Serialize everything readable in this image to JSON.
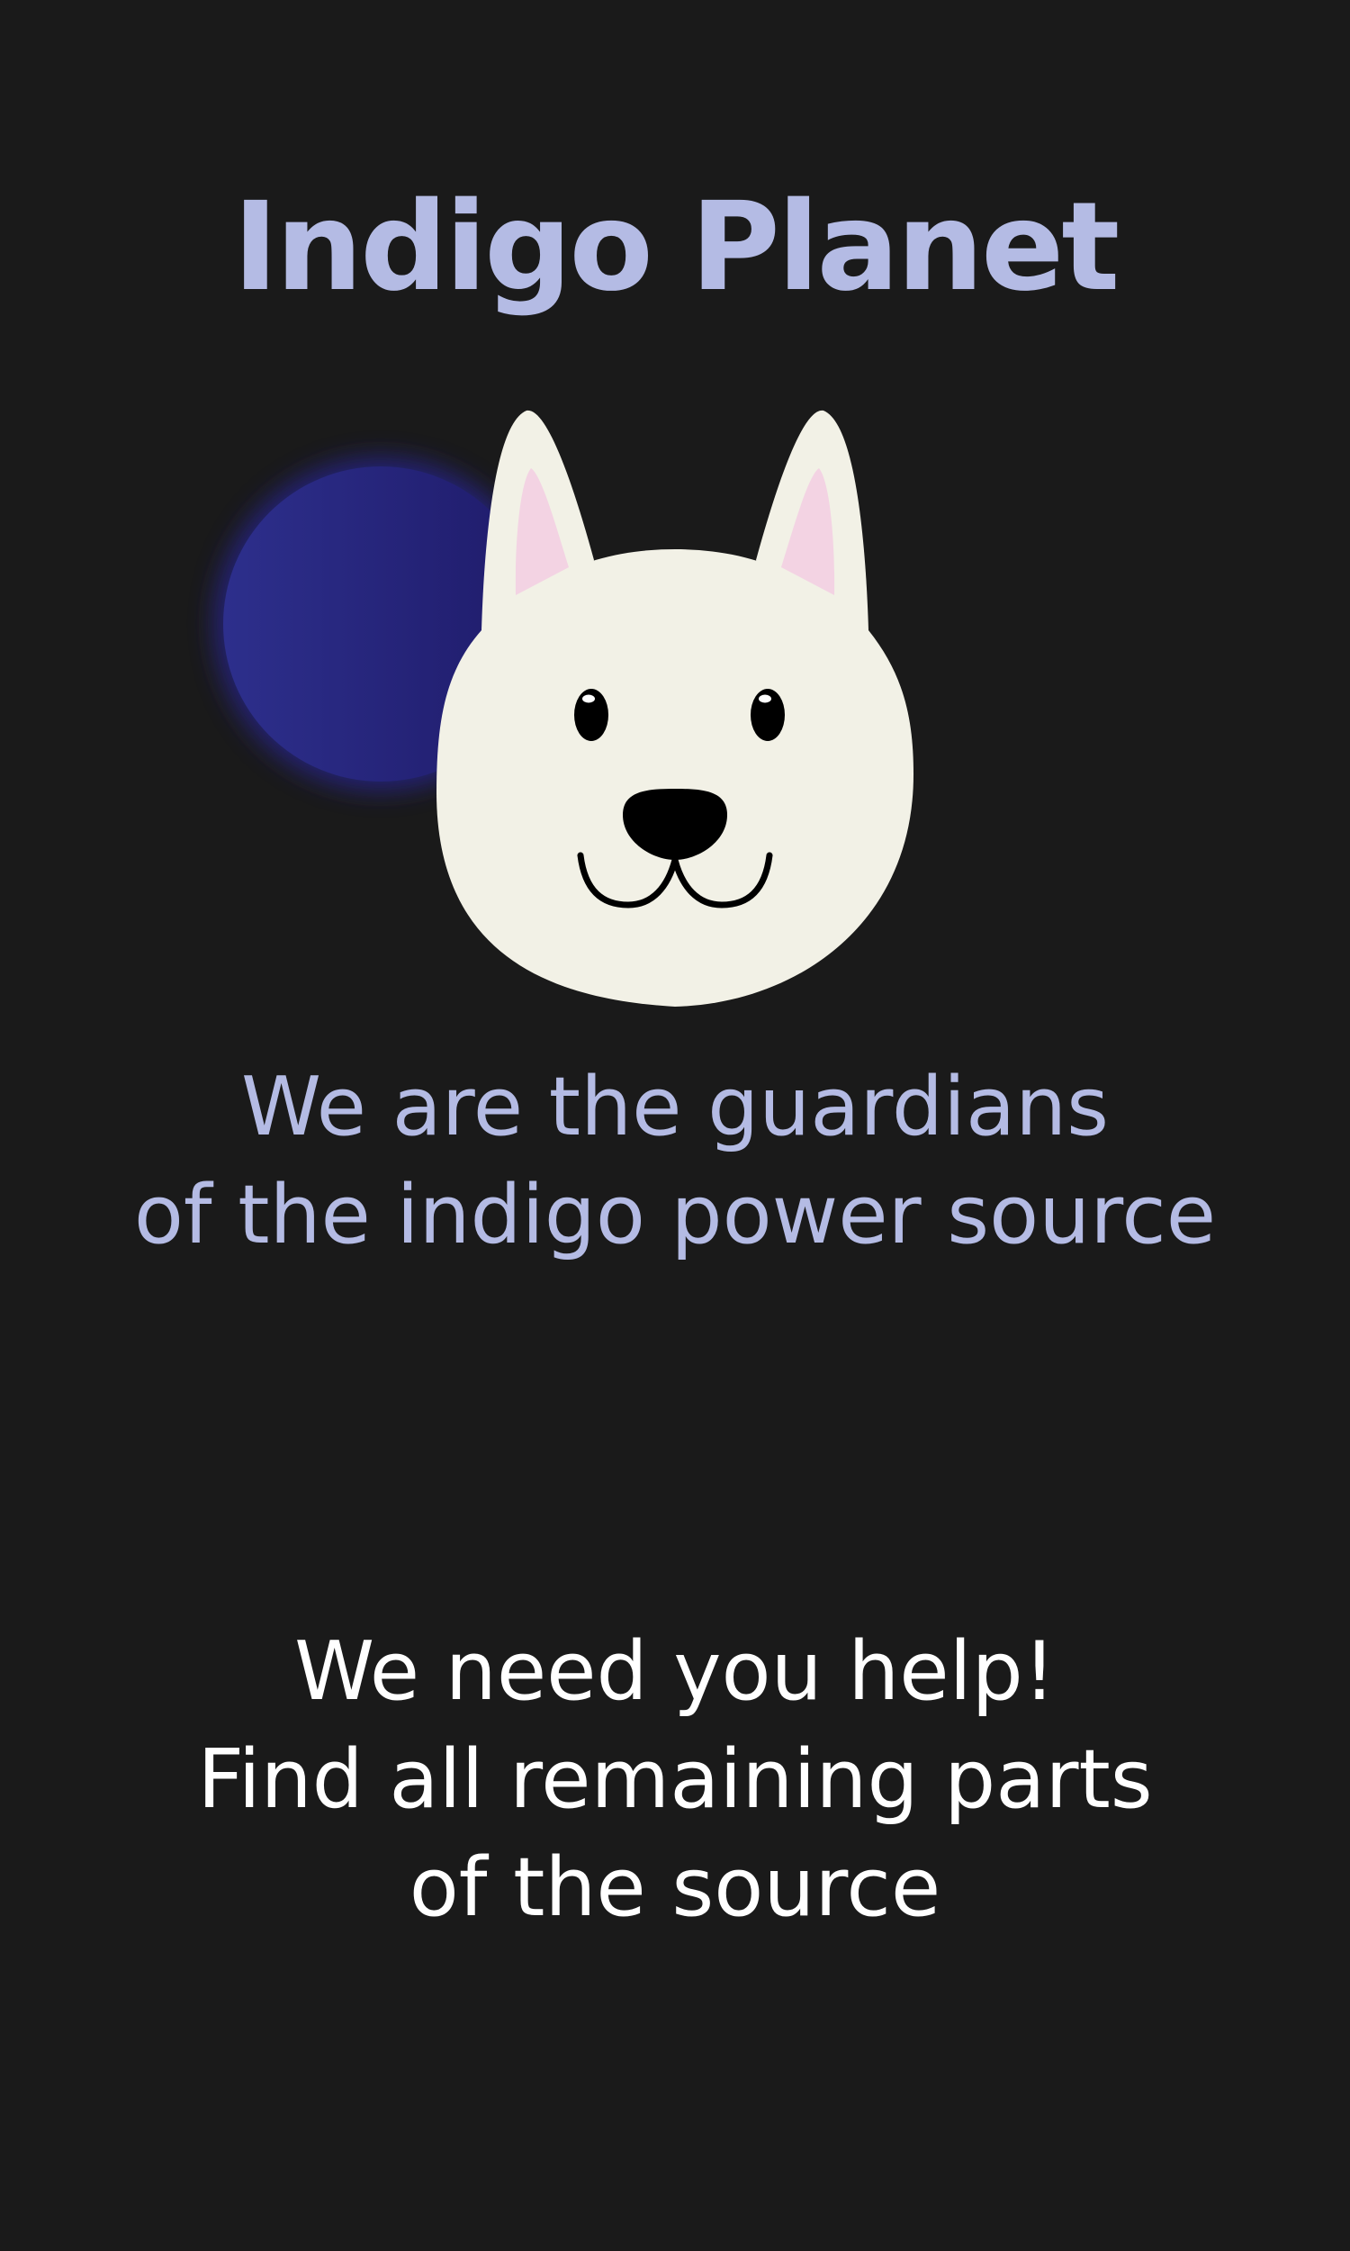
{
  "title": "Indigo Planet",
  "tagline": {
    "line1": "We are the guardians",
    "line2": "of the indigo power source"
  },
  "callout": {
    "line1": "We need you help!",
    "line2": "Find all remaining parts",
    "line3": "of the source"
  },
  "illustration": {
    "planet": "indigo-planet-icon",
    "mascot": "dog-face-icon"
  },
  "colors": {
    "background": "#1a1a1a",
    "accent_text": "#b4bbe4",
    "body_text": "#ffffff",
    "planet": "#26237a",
    "dog_face": "#f2f1e6",
    "ear_inner": "#f3d3e3"
  }
}
